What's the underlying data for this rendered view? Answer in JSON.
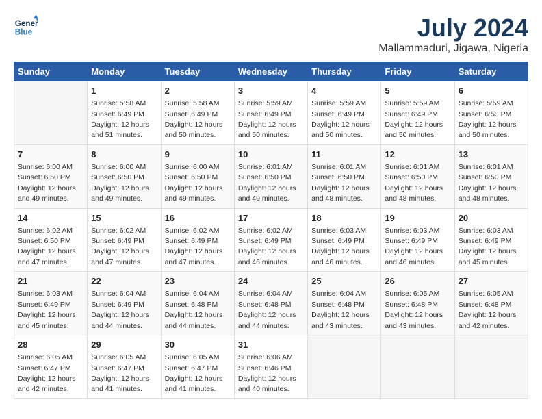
{
  "header": {
    "logo_text_general": "General",
    "logo_text_blue": "Blue",
    "month_title": "July 2024",
    "location": "Mallammaduri, Jigawa, Nigeria"
  },
  "calendar": {
    "days_of_week": [
      "Sunday",
      "Monday",
      "Tuesday",
      "Wednesday",
      "Thursday",
      "Friday",
      "Saturday"
    ],
    "weeks": [
      [
        {
          "day": "",
          "sunrise": "",
          "sunset": "",
          "daylight": ""
        },
        {
          "day": "1",
          "sunrise": "Sunrise: 5:58 AM",
          "sunset": "Sunset: 6:49 PM",
          "daylight": "Daylight: 12 hours and 51 minutes."
        },
        {
          "day": "2",
          "sunrise": "Sunrise: 5:58 AM",
          "sunset": "Sunset: 6:49 PM",
          "daylight": "Daylight: 12 hours and 50 minutes."
        },
        {
          "day": "3",
          "sunrise": "Sunrise: 5:59 AM",
          "sunset": "Sunset: 6:49 PM",
          "daylight": "Daylight: 12 hours and 50 minutes."
        },
        {
          "day": "4",
          "sunrise": "Sunrise: 5:59 AM",
          "sunset": "Sunset: 6:49 PM",
          "daylight": "Daylight: 12 hours and 50 minutes."
        },
        {
          "day": "5",
          "sunrise": "Sunrise: 5:59 AM",
          "sunset": "Sunset: 6:49 PM",
          "daylight": "Daylight: 12 hours and 50 minutes."
        },
        {
          "day": "6",
          "sunrise": "Sunrise: 5:59 AM",
          "sunset": "Sunset: 6:50 PM",
          "daylight": "Daylight: 12 hours and 50 minutes."
        }
      ],
      [
        {
          "day": "7",
          "sunrise": "Sunrise: 6:00 AM",
          "sunset": "Sunset: 6:50 PM",
          "daylight": "Daylight: 12 hours and 49 minutes."
        },
        {
          "day": "8",
          "sunrise": "Sunrise: 6:00 AM",
          "sunset": "Sunset: 6:50 PM",
          "daylight": "Daylight: 12 hours and 49 minutes."
        },
        {
          "day": "9",
          "sunrise": "Sunrise: 6:00 AM",
          "sunset": "Sunset: 6:50 PM",
          "daylight": "Daylight: 12 hours and 49 minutes."
        },
        {
          "day": "10",
          "sunrise": "Sunrise: 6:01 AM",
          "sunset": "Sunset: 6:50 PM",
          "daylight": "Daylight: 12 hours and 49 minutes."
        },
        {
          "day": "11",
          "sunrise": "Sunrise: 6:01 AM",
          "sunset": "Sunset: 6:50 PM",
          "daylight": "Daylight: 12 hours and 48 minutes."
        },
        {
          "day": "12",
          "sunrise": "Sunrise: 6:01 AM",
          "sunset": "Sunset: 6:50 PM",
          "daylight": "Daylight: 12 hours and 48 minutes."
        },
        {
          "day": "13",
          "sunrise": "Sunrise: 6:01 AM",
          "sunset": "Sunset: 6:50 PM",
          "daylight": "Daylight: 12 hours and 48 minutes."
        }
      ],
      [
        {
          "day": "14",
          "sunrise": "Sunrise: 6:02 AM",
          "sunset": "Sunset: 6:50 PM",
          "daylight": "Daylight: 12 hours and 47 minutes."
        },
        {
          "day": "15",
          "sunrise": "Sunrise: 6:02 AM",
          "sunset": "Sunset: 6:49 PM",
          "daylight": "Daylight: 12 hours and 47 minutes."
        },
        {
          "day": "16",
          "sunrise": "Sunrise: 6:02 AM",
          "sunset": "Sunset: 6:49 PM",
          "daylight": "Daylight: 12 hours and 47 minutes."
        },
        {
          "day": "17",
          "sunrise": "Sunrise: 6:02 AM",
          "sunset": "Sunset: 6:49 PM",
          "daylight": "Daylight: 12 hours and 46 minutes."
        },
        {
          "day": "18",
          "sunrise": "Sunrise: 6:03 AM",
          "sunset": "Sunset: 6:49 PM",
          "daylight": "Daylight: 12 hours and 46 minutes."
        },
        {
          "day": "19",
          "sunrise": "Sunrise: 6:03 AM",
          "sunset": "Sunset: 6:49 PM",
          "daylight": "Daylight: 12 hours and 46 minutes."
        },
        {
          "day": "20",
          "sunrise": "Sunrise: 6:03 AM",
          "sunset": "Sunset: 6:49 PM",
          "daylight": "Daylight: 12 hours and 45 minutes."
        }
      ],
      [
        {
          "day": "21",
          "sunrise": "Sunrise: 6:03 AM",
          "sunset": "Sunset: 6:49 PM",
          "daylight": "Daylight: 12 hours and 45 minutes."
        },
        {
          "day": "22",
          "sunrise": "Sunrise: 6:04 AM",
          "sunset": "Sunset: 6:49 PM",
          "daylight": "Daylight: 12 hours and 44 minutes."
        },
        {
          "day": "23",
          "sunrise": "Sunrise: 6:04 AM",
          "sunset": "Sunset: 6:48 PM",
          "daylight": "Daylight: 12 hours and 44 minutes."
        },
        {
          "day": "24",
          "sunrise": "Sunrise: 6:04 AM",
          "sunset": "Sunset: 6:48 PM",
          "daylight": "Daylight: 12 hours and 44 minutes."
        },
        {
          "day": "25",
          "sunrise": "Sunrise: 6:04 AM",
          "sunset": "Sunset: 6:48 PM",
          "daylight": "Daylight: 12 hours and 43 minutes."
        },
        {
          "day": "26",
          "sunrise": "Sunrise: 6:05 AM",
          "sunset": "Sunset: 6:48 PM",
          "daylight": "Daylight: 12 hours and 43 minutes."
        },
        {
          "day": "27",
          "sunrise": "Sunrise: 6:05 AM",
          "sunset": "Sunset: 6:48 PM",
          "daylight": "Daylight: 12 hours and 42 minutes."
        }
      ],
      [
        {
          "day": "28",
          "sunrise": "Sunrise: 6:05 AM",
          "sunset": "Sunset: 6:47 PM",
          "daylight": "Daylight: 12 hours and 42 minutes."
        },
        {
          "day": "29",
          "sunrise": "Sunrise: 6:05 AM",
          "sunset": "Sunset: 6:47 PM",
          "daylight": "Daylight: 12 hours and 41 minutes."
        },
        {
          "day": "30",
          "sunrise": "Sunrise: 6:05 AM",
          "sunset": "Sunset: 6:47 PM",
          "daylight": "Daylight: 12 hours and 41 minutes."
        },
        {
          "day": "31",
          "sunrise": "Sunrise: 6:06 AM",
          "sunset": "Sunset: 6:46 PM",
          "daylight": "Daylight: 12 hours and 40 minutes."
        },
        {
          "day": "",
          "sunrise": "",
          "sunset": "",
          "daylight": ""
        },
        {
          "day": "",
          "sunrise": "",
          "sunset": "",
          "daylight": ""
        },
        {
          "day": "",
          "sunrise": "",
          "sunset": "",
          "daylight": ""
        }
      ]
    ]
  }
}
